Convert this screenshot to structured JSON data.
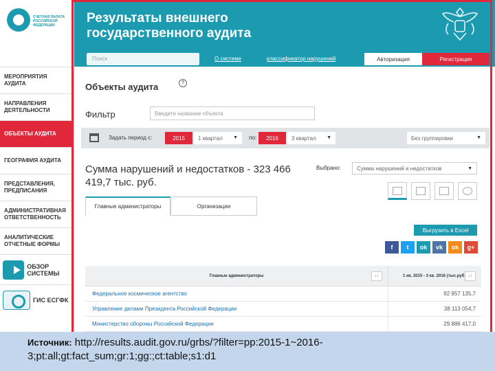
{
  "sidebar": {
    "logo_text": "СЧЕТНАЯ ПАЛАТА РОССИЙСКОЙ ФЕДЕРАЦИИ",
    "items": [
      {
        "label": "МЕРОПРИЯТИЯ АУДИТА",
        "active": false
      },
      {
        "label": "НАПРАВЛЕНИЯ ДЕЯТЕЛЬНОСТИ",
        "active": false
      },
      {
        "label": "ОБЪЕКТЫ АУДИТА",
        "active": true
      },
      {
        "label": "ГЕОГРАФИЯ АУДИТА",
        "active": false
      },
      {
        "label": "ПРЕДСТАВЛЕНИЯ, ПРЕДПИСАНИЯ",
        "active": false
      },
      {
        "label": "АДМИНИСТРАТИВНАЯ ОТВЕТСТВЕННОСТЬ",
        "active": false
      },
      {
        "label": "АНАЛИТИЧЕСКИЕ ОТЧЕТНЫЕ ФОРМЫ",
        "active": false
      }
    ],
    "promo_overview": "ОБЗОР СИСТЕМЫ",
    "promo_gis": "ГИС ЕСГФК"
  },
  "header": {
    "title": "Результаты внешнего государственного аудита",
    "search_placeholder": "Поиск",
    "link_about": "О системе",
    "link_classifier": "классификатор нарушений",
    "auth_label": "Авторизация",
    "register_label": "Регистрация"
  },
  "main": {
    "section_title": "Объекты аудита",
    "help_glyph": "?",
    "filter_label": "Фильтр",
    "filter_placeholder": "Введите название объекта",
    "period": {
      "label_from": "Задать период с:",
      "year_from": "2015",
      "quarter_from": "1 квартал",
      "label_to": "по:",
      "year_to": "2016",
      "quarter_to": "3 квартал",
      "grouping": "Без группировки"
    },
    "sum_title": "Сумма нарушений и недостатков - 323 466 419,7 тыс. руб.",
    "chosen_label": "Выбрано:",
    "chosen_value": "Сумма нарушений и недостатков",
    "tabs": [
      "Главные администраторы",
      "Организации"
    ],
    "export_label": "Выгрузить в Excel",
    "social": [
      {
        "label": "f",
        "color": "#3b5998"
      },
      {
        "label": "t",
        "color": "#1da1f2"
      },
      {
        "label": "ok",
        "color": "#1b9ab0"
      },
      {
        "label": "vk",
        "color": "#4c75a3"
      },
      {
        "label": "ok",
        "color": "#f08a1c"
      },
      {
        "label": "g+",
        "color": "#dd4b39"
      }
    ],
    "table": {
      "col1_header": "Главные администраторы",
      "col2_header": "1 кв. 2015 - 3 кв. 2016 (тыс.руб.)",
      "sort_glyph": "↓↑",
      "rows": [
        {
          "name": "Федеральное космическое агентство",
          "value": "92 957 135,7"
        },
        {
          "name": "Управление делами Президента Российской Федерации",
          "value": "38 113 054,7"
        },
        {
          "name": "Министерство обороны Российской Федерации",
          "value": "29 886 417,0"
        }
      ]
    }
  },
  "caption": {
    "label": "Источник:",
    "text": "http://results.audit.gov.ru/grbs/?filter=pp:2015-1~2016-3;pt:all;gt:fact_sum;gr:1;gg:;ct:table;s1:d1"
  },
  "colors": {
    "teal": "#1b9ab0",
    "red": "#e0283a",
    "link": "#1a6fb4"
  }
}
